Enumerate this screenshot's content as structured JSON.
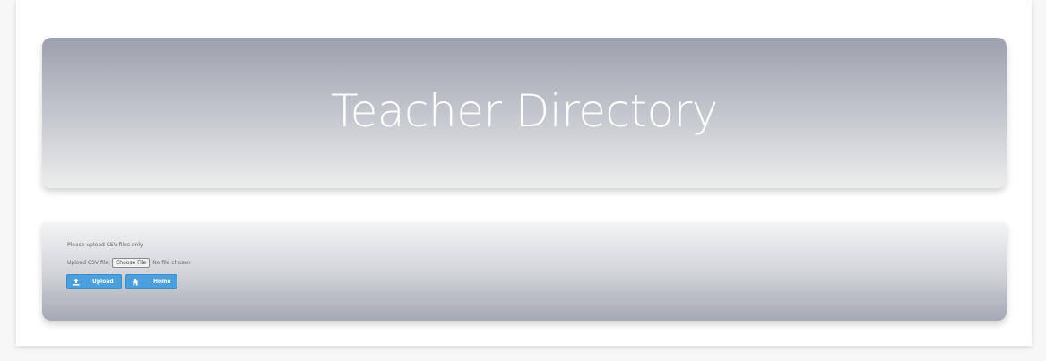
{
  "header": {
    "title": "Teacher Directory"
  },
  "upload": {
    "note": "Please upload CSV files only.",
    "file_label": "Upload CSV file:",
    "choose_file_label": "Choose File",
    "no_file_text": "No file chosen",
    "upload_button": {
      "label": "Upload",
      "icon": "upload-icon"
    },
    "home_button": {
      "label": "Home",
      "icon": "home-icon"
    }
  },
  "colors": {
    "button_blue": "#4a9fdc",
    "title_white": "#ffffff"
  }
}
